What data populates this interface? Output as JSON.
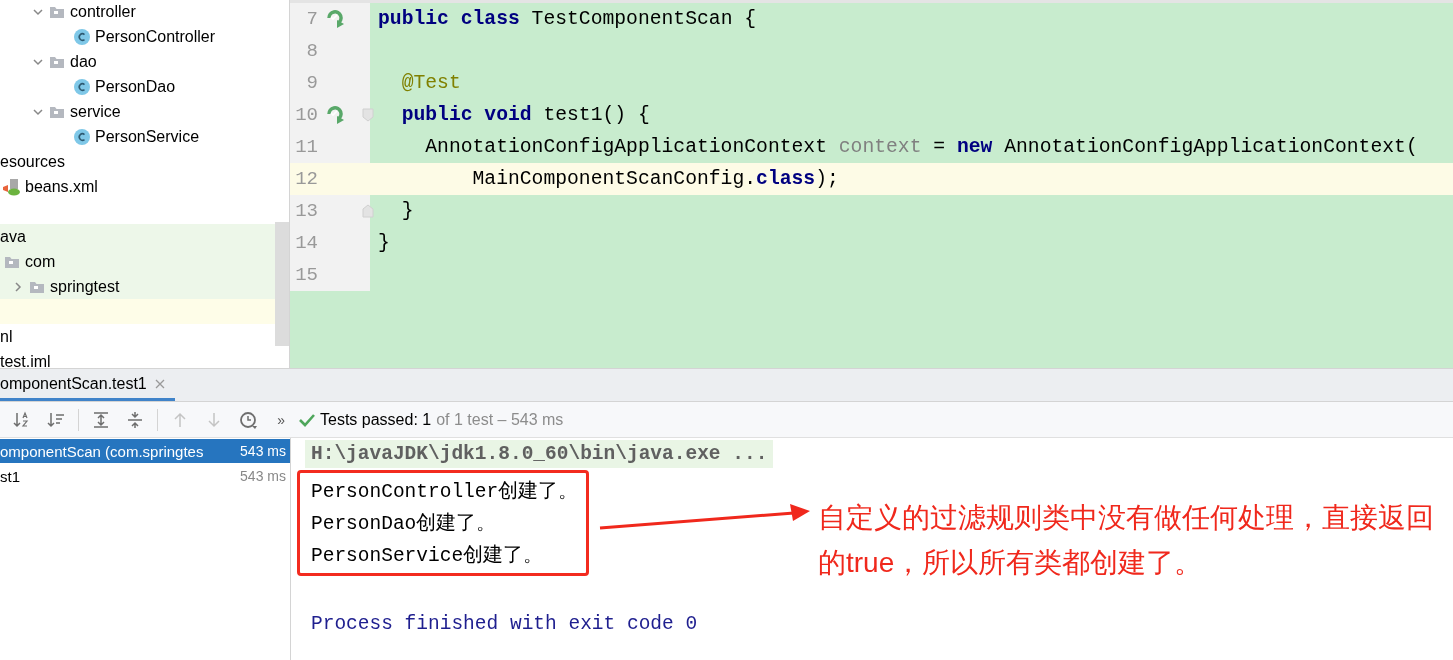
{
  "project_tree": {
    "groups": [
      {
        "highlighted": false,
        "items": [
          {
            "label": "controller",
            "kind": "folder",
            "expanded": true,
            "children": [
              {
                "label": "PersonController",
                "kind": "class"
              }
            ]
          },
          {
            "label": "dao",
            "kind": "folder",
            "expanded": true,
            "children": [
              {
                "label": "PersonDao",
                "kind": "class"
              }
            ]
          },
          {
            "label": "service",
            "kind": "folder",
            "expanded": true,
            "children": [
              {
                "label": "PersonService",
                "kind": "class"
              }
            ]
          }
        ]
      },
      {
        "highlighted": false,
        "items": [
          {
            "label": "esources",
            "kind": "text",
            "children": [
              {
                "label": "beans.xml",
                "kind": "xml"
              }
            ]
          }
        ]
      },
      {
        "highlighted": true,
        "items": [
          {
            "label": "ava",
            "kind": "text",
            "children": [
              {
                "label": "com",
                "kind": "folder",
                "children": [
                  {
                    "label": "springtest",
                    "kind": "folder",
                    "expanded": false
                  }
                ]
              }
            ]
          }
        ]
      },
      {
        "highlighted": false,
        "items": [
          {
            "label": "nl",
            "kind": "text"
          },
          {
            "label": "test.iml",
            "kind": "text"
          }
        ]
      }
    ]
  },
  "editor": {
    "lines": [
      {
        "number": "7",
        "run_icon": true,
        "current": false,
        "tokens": [
          {
            "text": "public class",
            "kind": "keyword"
          },
          {
            "text": " TestComponentScan {",
            "kind": "plain"
          }
        ]
      },
      {
        "number": "8",
        "run_icon": false,
        "current": false
      },
      {
        "number": "9",
        "run_icon": false,
        "current": false,
        "tokens": [
          {
            "text": "  @Test",
            "kind": "annotation"
          }
        ]
      },
      {
        "number": "10",
        "run_icon": true,
        "current": false,
        "fold_start": true,
        "tokens": [
          {
            "text": "  public void",
            "kind": "keyword"
          },
          {
            "text": " test1() {",
            "kind": "plain"
          }
        ]
      },
      {
        "number": "11",
        "run_icon": false,
        "current": false,
        "tokens": [
          {
            "text": "    AnnotationConfigApplicationContext ",
            "kind": "plain"
          },
          {
            "text": "context",
            "kind": "local"
          },
          {
            "text": " = ",
            "kind": "plain"
          },
          {
            "text": "new",
            "kind": "keyword"
          },
          {
            "text": " AnnotationConfigApplicationContext(",
            "kind": "plain"
          }
        ]
      },
      {
        "number": "12",
        "run_icon": false,
        "current": true,
        "tokens": [
          {
            "text": "        MainComponentScanConfig.",
            "kind": "plain"
          },
          {
            "text": "class",
            "kind": "keyword"
          },
          {
            "text": ");",
            "kind": "plain"
          }
        ]
      },
      {
        "number": "13",
        "run_icon": false,
        "current": false,
        "fold_end": true,
        "tokens": [
          {
            "text": "  }",
            "kind": "plain"
          }
        ]
      },
      {
        "number": "14",
        "run_icon": false,
        "current": false,
        "tokens": [
          {
            "text": "}",
            "kind": "plain"
          }
        ]
      },
      {
        "number": "15",
        "run_icon": false,
        "current": false
      }
    ]
  },
  "run_panel": {
    "tabs": [
      {
        "label": "omponentScan.test1",
        "selected": true
      }
    ],
    "toolbar": [
      {
        "kind": "sort-alpha",
        "disabled": false
      },
      {
        "kind": "sort-duration",
        "disabled": false
      },
      {
        "kind": "expand-all",
        "disabled": false
      },
      {
        "kind": "collapse-all",
        "disabled": false
      },
      {
        "kind": "previous",
        "disabled": true
      },
      {
        "kind": "next",
        "disabled": true
      },
      {
        "kind": "history",
        "disabled": false
      }
    ],
    "overflow": "»",
    "status": {
      "passed": "Tests passed: 1",
      "detail": "of 1 test – 543 ms"
    },
    "test_tree": [
      {
        "label": "omponentScan (com.springtes",
        "time": "543 ms",
        "selected": true
      },
      {
        "label": "st1",
        "time": "543 ms",
        "selected": false
      }
    ],
    "console": [
      {
        "text": "H:\\javaJDK\\jdk1.8.0_60\\bin\\java.exe ...",
        "kind": "command"
      },
      {
        "text": "PersonController创建了。",
        "kind": "output"
      },
      {
        "text": "PersonDao创建了。",
        "kind": "output"
      },
      {
        "text": "PersonService创建了。",
        "kind": "output"
      },
      {
        "text": "Process finished with exit code 0",
        "kind": "exit"
      }
    ]
  },
  "annotation": {
    "text": "自定义的过滤规则类中没有做任何处理，直接返回的true，所以所有类都创建了。"
  }
}
